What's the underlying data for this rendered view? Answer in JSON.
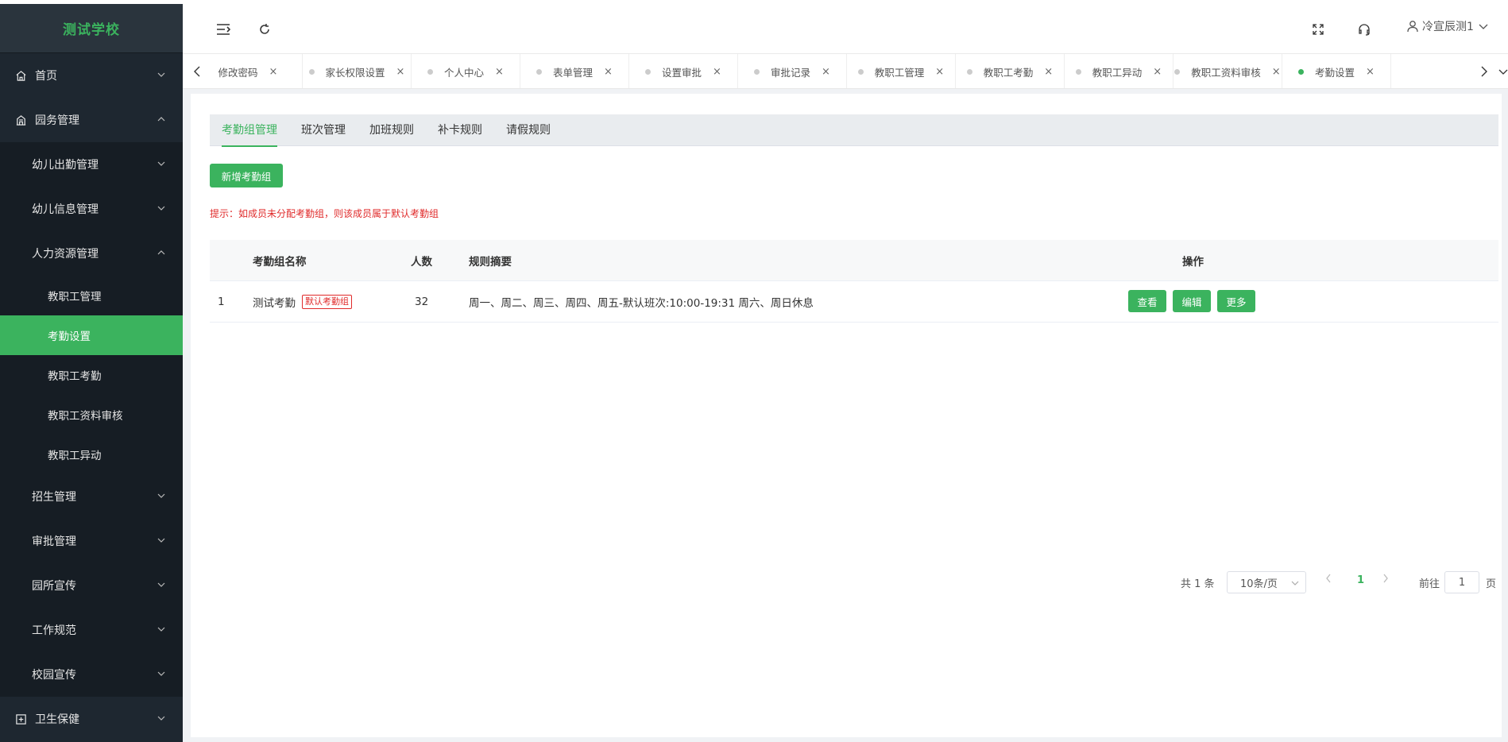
{
  "sidebar": {
    "brand": "测试学校",
    "items": [
      {
        "label": "首页",
        "icon": "home-icon"
      },
      {
        "label": "园务管理",
        "icon": "building-icon"
      },
      {
        "label": "幼儿出勤管理"
      },
      {
        "label": "幼儿信息管理"
      },
      {
        "label": "人力资源管理"
      },
      {
        "label": "教职工管理"
      },
      {
        "label": "考勤设置"
      },
      {
        "label": "教职工考勤"
      },
      {
        "label": "教职工资料审核"
      },
      {
        "label": "教职工异动"
      },
      {
        "label": "招生管理"
      },
      {
        "label": "审批管理"
      },
      {
        "label": "园所宣传"
      },
      {
        "label": "工作规范"
      },
      {
        "label": "校园宣传"
      },
      {
        "label": "卫生保健",
        "icon": "health-icon"
      }
    ]
  },
  "header": {
    "user": "冷宣辰测1"
  },
  "tabs": [
    {
      "label": "修改密码"
    },
    {
      "label": "家长权限设置"
    },
    {
      "label": "个人中心"
    },
    {
      "label": "表单管理"
    },
    {
      "label": "设置审批"
    },
    {
      "label": "审批记录"
    },
    {
      "label": "教职工管理"
    },
    {
      "label": "教职工考勤"
    },
    {
      "label": "教职工异动"
    },
    {
      "label": "教职工资料审核"
    },
    {
      "label": "考勤设置",
      "active": true
    }
  ],
  "main": {
    "sub_tabs": [
      "考勤组管理",
      "班次管理",
      "加班规则",
      "补卡规则",
      "请假规则"
    ],
    "add_button": "新增考勤组",
    "tip": "提示：如成员未分配考勤组，则该成员属于默认考勤组",
    "table": {
      "headers": [
        "考勤组名称",
        "人数",
        "规则摘要",
        "操作"
      ],
      "rows": [
        {
          "index": "1",
          "name": "测试考勤",
          "tag": "默认考勤组",
          "count": "32",
          "summary": "周一、周二、周三、周四、周五-默认班次:10:00-19:31  周六、周日休息",
          "actions": [
            "查看",
            "编辑",
            "更多"
          ]
        }
      ]
    },
    "pagination": {
      "total": "共 1 条",
      "page_size": "10条/页",
      "current_page": "1",
      "goto_label": "前往",
      "goto_value": "1",
      "page_unit": "页"
    }
  },
  "colors": {
    "accent": "#3bb35e",
    "sidebar_bg": "#1e2730",
    "warning": "#e02a2a"
  }
}
